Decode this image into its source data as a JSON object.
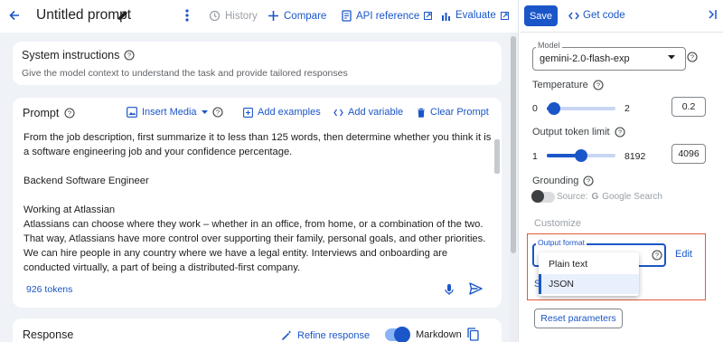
{
  "header": {
    "title": "Untitled prompt",
    "history_label": "History",
    "compare_label": "Compare",
    "api_reference_label": "API reference",
    "evaluate_label": "Evaluate"
  },
  "system_instructions": {
    "title": "System instructions",
    "subtitle": "Give the model context to understand the task and provide tailored responses"
  },
  "prompt": {
    "title": "Prompt",
    "insert_media_label": "Insert Media",
    "add_examples_label": "Add examples",
    "add_variable_label": "Add variable",
    "clear_prompt_label": "Clear Prompt",
    "paragraphs": [
      "From the job description, first summarize it to less than 125 words, then determine whether you think it is a software engineering job and your confidence percentage.",
      "Backend Software Engineer",
      "Working at Atlassian",
      "Atlassians can choose where they work – whether in an office, from home, or a combination of the two. That way, Atlassians have more control over supporting their family, personal goals, and other priorities. We can hire people in any country where we have a legal entity. Interviews and onboarding are conducted virtually, a part of being a distributed-first company."
    ],
    "tokens_label": "926 tokens"
  },
  "response": {
    "title": "Response",
    "refine_label": "Refine response",
    "markdown_label": "Markdown"
  },
  "right_panel": {
    "save_label": "Save",
    "get_code_label": "Get code",
    "model_legend": "Model",
    "model_value": "gemini-2.0-flash-exp",
    "temperature": {
      "label": "Temperature",
      "min": "0",
      "max": "2",
      "value": "0.2",
      "fraction": 0.1
    },
    "output_token_limit": {
      "label": "Output token limit",
      "min": "1",
      "max": "8192",
      "value": "4096",
      "fraction": 0.5
    },
    "grounding": {
      "label": "Grounding",
      "source_label": "Source:",
      "google_label": "Google Search"
    },
    "customize_label": "Customize",
    "output_format": {
      "legend": "Output format",
      "edit_label": "Edit",
      "options": [
        "Plain text",
        "JSON"
      ],
      "selected": "JSON"
    },
    "stop_sequence_partial": "S",
    "reset_label": "Reset parameters"
  },
  "colors": {
    "accent": "#1a56c8",
    "highlight_border": "#e05a3a"
  }
}
